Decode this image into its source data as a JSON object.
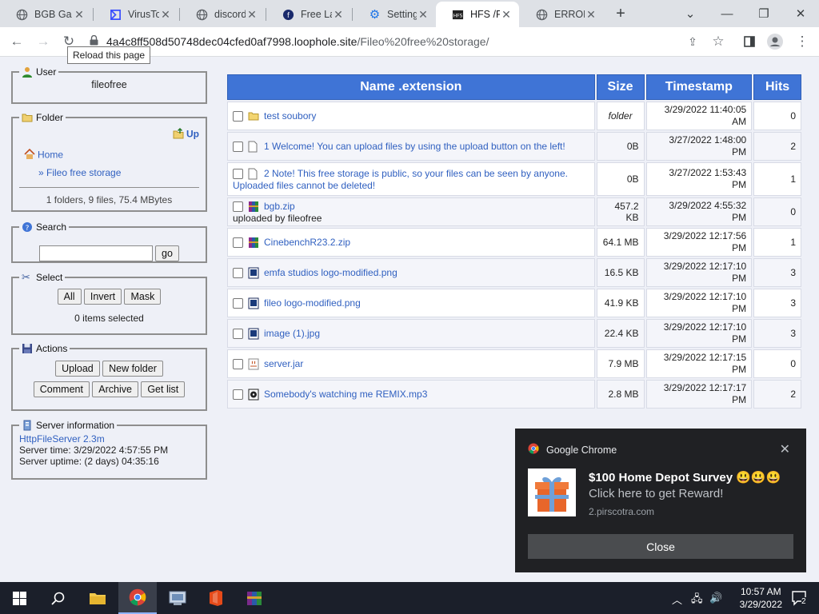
{
  "browser": {
    "tabs": [
      {
        "title": "BGB Ga",
        "active": false
      },
      {
        "title": "VirusTo",
        "active": false
      },
      {
        "title": "discord",
        "active": false
      },
      {
        "title": "Free La",
        "active": false
      },
      {
        "title": "Setting",
        "active": false
      },
      {
        "title": "HFS /Fi",
        "active": true
      },
      {
        "title": "ERROR",
        "active": false
      }
    ],
    "url_host": "4a4c8ff508d50748dec04cfed0af7998.loophole.site",
    "url_path": "/Fileo%20free%20storage/",
    "tooltip": "Reload this page"
  },
  "sidebar": {
    "user": {
      "legend": "User",
      "name": "fileofree"
    },
    "folder": {
      "legend": "Folder",
      "up": "Up",
      "home": "Home",
      "current": "» Fileo free storage",
      "summary": "1 folders, 9 files, 75.4 MBytes"
    },
    "search": {
      "legend": "Search",
      "go": "go",
      "value": ""
    },
    "select": {
      "legend": "Select",
      "all": "All",
      "invert": "Invert",
      "mask": "Mask",
      "status": "0 items selected"
    },
    "actions": {
      "legend": "Actions",
      "upload": "Upload",
      "new_folder": "New folder",
      "comment": "Comment",
      "archive": "Archive",
      "get_list": "Get list"
    },
    "server": {
      "legend": "Server information",
      "version": "HttpFileServer 2.3m",
      "time": "Server time: 3/29/2022 4:57:55 PM",
      "uptime": "Server uptime: (2 days) 04:35:16"
    }
  },
  "table": {
    "headers": {
      "name": "Name .extension",
      "size": "Size",
      "timestamp": "Timestamp",
      "hits": "Hits"
    },
    "rows": [
      {
        "name": "test soubory",
        "note": "",
        "icon": "folder-icon",
        "size": "folder",
        "stamp1": "3/29/2022 11:40:05",
        "stamp2": "AM",
        "hits": "0"
      },
      {
        "name": "1 Welcome! You can upload files by using the upload button on the left!",
        "note": "",
        "icon": "file-icon",
        "size": "0B",
        "stamp1": "3/27/2022 1:48:00",
        "stamp2": "PM",
        "hits": "2"
      },
      {
        "name": "2 Note! This free storage is public, so your files can be seen by anyone. Uploaded files cannot be deleted!",
        "note": "",
        "icon": "file-icon",
        "size": "0B",
        "stamp1": "3/27/2022 1:53:43",
        "stamp2": "PM",
        "hits": "1"
      },
      {
        "name": "bgb.zip",
        "note": "uploaded by fileofree",
        "icon": "archive-icon",
        "size": "457.2 KB",
        "stamp1": "3/29/2022 4:55:32",
        "stamp2": "PM",
        "hits": "0"
      },
      {
        "name": "CinebenchR23.2.zip",
        "note": "",
        "icon": "archive-icon",
        "size": "64.1 MB",
        "stamp1": "3/29/2022 12:17:56",
        "stamp2": "PM",
        "hits": "1"
      },
      {
        "name": "emfa studios logo-modified.png",
        "note": "",
        "icon": "image-icon",
        "size": "16.5 KB",
        "stamp1": "3/29/2022 12:17:10",
        "stamp2": "PM",
        "hits": "3"
      },
      {
        "name": "fileo logo-modified.png",
        "note": "",
        "icon": "image-icon",
        "size": "41.9 KB",
        "stamp1": "3/29/2022 12:17:10",
        "stamp2": "PM",
        "hits": "3"
      },
      {
        "name": "image (1).jpg",
        "note": "",
        "icon": "image-icon",
        "size": "22.4 KB",
        "stamp1": "3/29/2022 12:17:10",
        "stamp2": "PM",
        "hits": "3"
      },
      {
        "name": "server.jar",
        "note": "",
        "icon": "java-icon",
        "size": "7.9 MB",
        "stamp1": "3/29/2022 12:17:15",
        "stamp2": "PM",
        "hits": "0"
      },
      {
        "name": "Somebody's watching me REMIX.mp3",
        "note": "",
        "icon": "audio-icon",
        "size": "2.8 MB",
        "stamp1": "3/29/2022 12:17:17",
        "stamp2": "PM",
        "hits": "2"
      }
    ]
  },
  "notification": {
    "app": "Google Chrome",
    "title": "$100 Home Depot Survey 😃😃😃",
    "body": "Click here to get Reward!",
    "source": "2.pirscotra.com",
    "close_button": "Close"
  },
  "taskbar": {
    "time": "10:57 AM",
    "date": "3/29/2022",
    "notification_count": "2"
  },
  "colors": {
    "header_blue": "#3f74d6",
    "link": "#3060c0",
    "page_bg": "#eef0f7"
  }
}
